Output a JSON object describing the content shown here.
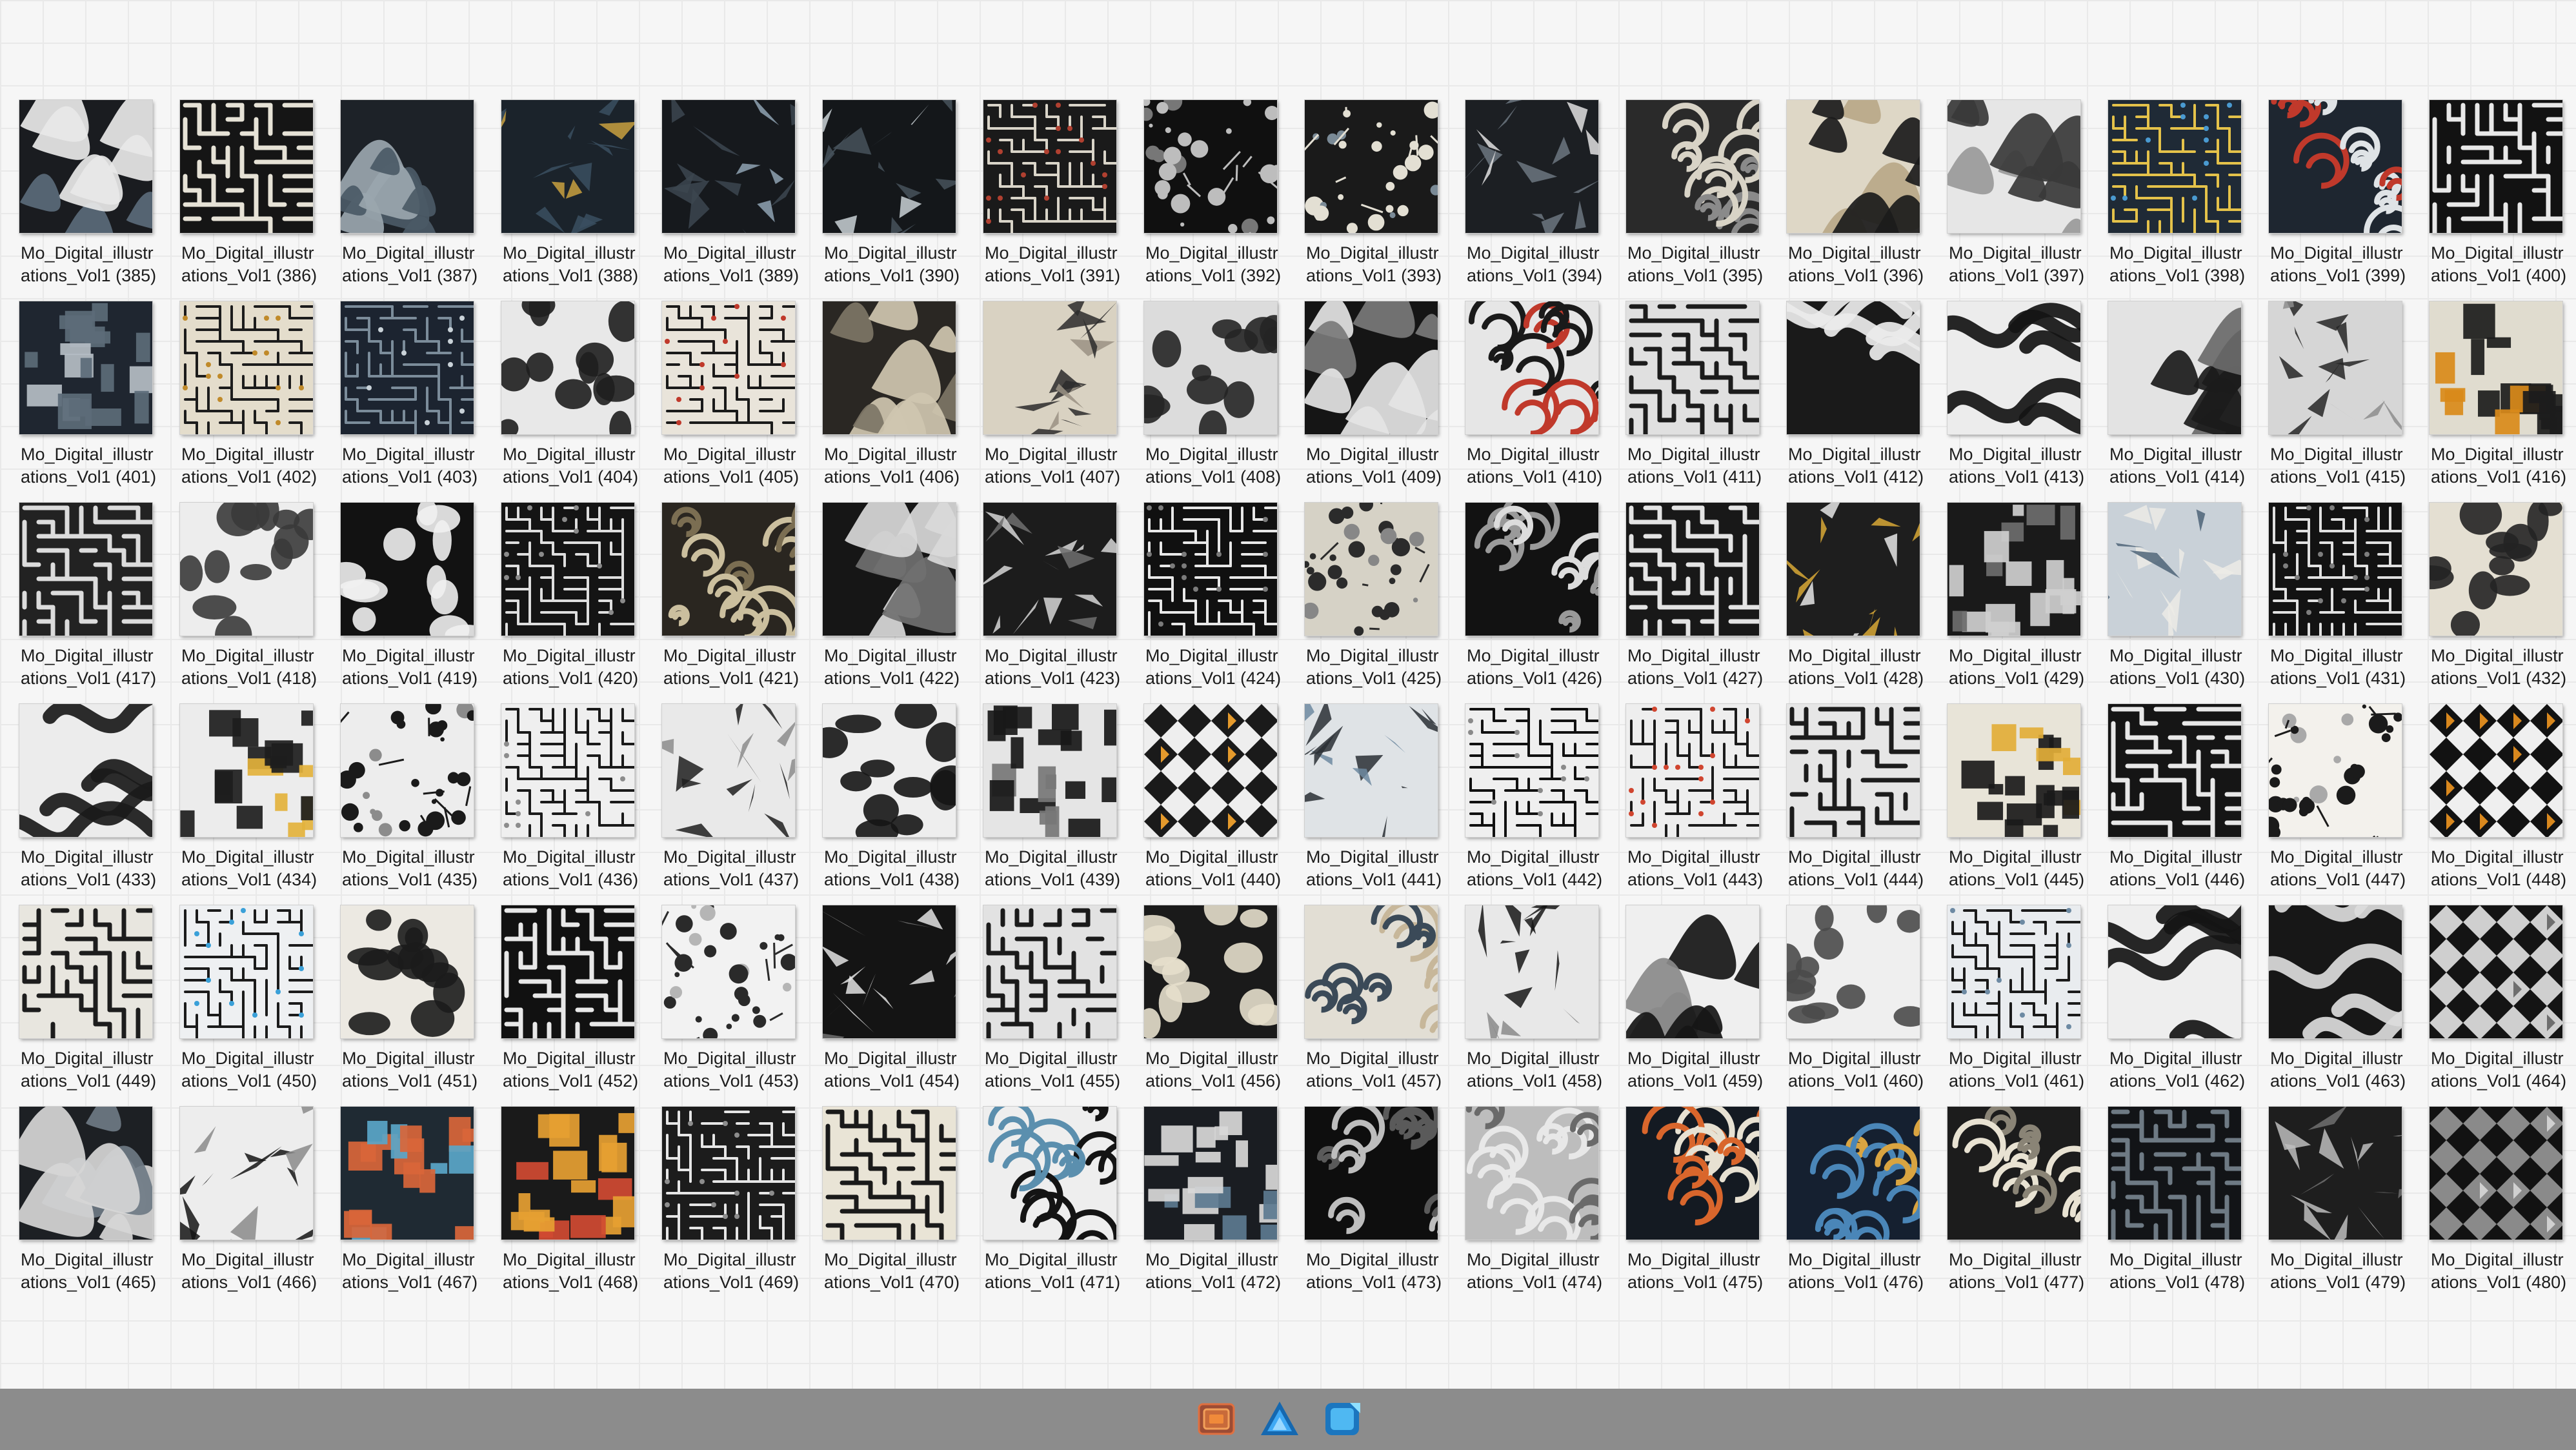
{
  "files": {
    "name_prefix": "Mo_Digital_illustrations_Vol1",
    "first_index": 385,
    "last_index": 480,
    "columns": 16,
    "items": [
      {
        "line1": "Mo_Digital_illustr",
        "line2": "ations_Vol1 (385)",
        "pattern": "blob",
        "bg": "#1a1c20",
        "fg": "#e8e8e8",
        "accent": "#5a6a7a"
      },
      {
        "line1": "Mo_Digital_illustr",
        "line2": "ations_Vol1 (386)",
        "pattern": "maze",
        "bg": "#151515",
        "fg": "#e6e2d6",
        "accent": "#9a9a9a"
      },
      {
        "line1": "Mo_Digital_illustr",
        "line2": "ations_Vol1 (387)",
        "pattern": "blob",
        "bg": "#1d2228",
        "fg": "#4b5a66",
        "accent": "#9aa6ae"
      },
      {
        "line1": "Mo_Digital_illustr",
        "line2": "ations_Vol1 (388)",
        "pattern": "shard",
        "bg": "#1b232b",
        "fg": "#3a4f60",
        "accent": "#c8a040"
      },
      {
        "line1": "Mo_Digital_illustr",
        "line2": "ations_Vol1 (389)",
        "pattern": "shard",
        "bg": "#16191d",
        "fg": "#3c4650",
        "accent": "#8fa3b3"
      },
      {
        "line1": "Mo_Digital_illustr",
        "line2": "ations_Vol1 (390)",
        "pattern": "shard",
        "bg": "#14171a",
        "fg": "#46525c",
        "accent": "#c9d1d6"
      },
      {
        "line1": "Mo_Digital_illustr",
        "line2": "ations_Vol1 (391)",
        "pattern": "circuit",
        "bg": "#1a1a1a",
        "fg": "#d9d4c8",
        "accent": "#b04030"
      },
      {
        "line1": "Mo_Digital_illustr",
        "line2": "ations_Vol1 (392)",
        "pattern": "dots",
        "bg": "#101010",
        "fg": "#bdbdbd",
        "accent": "#777777"
      },
      {
        "line1": "Mo_Digital_illustr",
        "line2": "ations_Vol1 (393)",
        "pattern": "dots",
        "bg": "#1a1a1a",
        "fg": "#e3dfd3",
        "accent": "#7a8a96"
      },
      {
        "line1": "Mo_Digital_illustr",
        "line2": "ations_Vol1 (394)",
        "pattern": "shard",
        "bg": "#1c1f23",
        "fg": "#6c7780",
        "accent": "#e0e0e0"
      },
      {
        "line1": "Mo_Digital_illustr",
        "line2": "ations_Vol1 (395)",
        "pattern": "swirl",
        "bg": "#2a2a2a",
        "fg": "#d8d3c6",
        "accent": "#8a8a8a"
      },
      {
        "line1": "Mo_Digital_illustr",
        "line2": "ations_Vol1 (396)",
        "pattern": "blob",
        "bg": "#ded7c6",
        "fg": "#1b1b1b",
        "accent": "#b8a888"
      },
      {
        "line1": "Mo_Digital_illustr",
        "line2": "ations_Vol1 (397)",
        "pattern": "blob",
        "bg": "#e6e6e6",
        "fg": "#3a3a3a",
        "accent": "#9a9a9a"
      },
      {
        "line1": "Mo_Digital_illustr",
        "line2": "ations_Vol1 (398)",
        "pattern": "circuit",
        "bg": "#1f2a36",
        "fg": "#e4c24a",
        "accent": "#4a9ad0"
      },
      {
        "line1": "Mo_Digital_illustr",
        "line2": "ations_Vol1 (399)",
        "pattern": "swirl",
        "bg": "#1e2630",
        "fg": "#dfe3e6",
        "accent": "#c0392b"
      },
      {
        "line1": "Mo_Digital_illustr",
        "line2": "ations_Vol1 (400)",
        "pattern": "maze",
        "bg": "#121212",
        "fg": "#e8e8e8",
        "accent": "#6a6a6a"
      },
      {
        "line1": "Mo_Digital_illustr",
        "line2": "ations_Vol1 (401)",
        "pattern": "blocks",
        "bg": "#1f2630",
        "fg": "#5c6b78",
        "accent": "#b5bdc4"
      },
      {
        "line1": "Mo_Digital_illustr",
        "line2": "ations_Vol1 (402)",
        "pattern": "circuit",
        "bg": "#e4ddcc",
        "fg": "#1c1c1c",
        "accent": "#c08a2a"
      },
      {
        "line1": "Mo_Digital_illustr",
        "line2": "ations_Vol1 (403)",
        "pattern": "circuit",
        "bg": "#1c2430",
        "fg": "#7b8c9a",
        "accent": "#c9d2d8"
      },
      {
        "line1": "Mo_Digital_illustr",
        "line2": "ations_Vol1 (404)",
        "pattern": "cells",
        "bg": "#e8e8e8",
        "fg": "#1e1e1e",
        "accent": "#9c9c9c"
      },
      {
        "line1": "Mo_Digital_illustr",
        "line2": "ations_Vol1 (405)",
        "pattern": "circuit",
        "bg": "#e9e4da",
        "fg": "#1a1a1a",
        "accent": "#c0392b"
      },
      {
        "line1": "Mo_Digital_illustr",
        "line2": "ations_Vol1 (406)",
        "pattern": "blob",
        "bg": "#2a2723",
        "fg": "#cfc6b0",
        "accent": "#7d7566"
      },
      {
        "line1": "Mo_Digital_illustr",
        "line2": "ations_Vol1 (407)",
        "pattern": "shard",
        "bg": "#d9d2c2",
        "fg": "#2b2b2b",
        "accent": "#9a9284"
      },
      {
        "line1": "Mo_Digital_illustr",
        "line2": "ations_Vol1 (408)",
        "pattern": "cells",
        "bg": "#dcdcdc",
        "fg": "#252525",
        "accent": "#8a8a8a"
      },
      {
        "line1": "Mo_Digital_illustr",
        "line2": "ations_Vol1 (409)",
        "pattern": "blob",
        "bg": "#151515",
        "fg": "#e4e4e4",
        "accent": "#7a7a7a"
      },
      {
        "line1": "Mo_Digital_illustr",
        "line2": "ations_Vol1 (410)",
        "pattern": "swirl",
        "bg": "#e6e6e6",
        "fg": "#1a1a1a",
        "accent": "#c0392b"
      },
      {
        "line1": "Mo_Digital_illustr",
        "line2": "ations_Vol1 (411)",
        "pattern": "maze",
        "bg": "#e0e0e0",
        "fg": "#1c1c1c",
        "accent": "#7a8a96"
      },
      {
        "line1": "Mo_Digital_illustr",
        "line2": "ations_Vol1 (412)",
        "pattern": "wave",
        "bg": "#1a1a1a",
        "fg": "#ececec",
        "accent": "#8a8a8a"
      },
      {
        "line1": "Mo_Digital_illustr",
        "line2": "ations_Vol1 (413)",
        "pattern": "wave",
        "bg": "#ececec",
        "fg": "#141414",
        "accent": "#8a8a8a"
      },
      {
        "line1": "Mo_Digital_illustr",
        "line2": "ations_Vol1 (414)",
        "pattern": "blob",
        "bg": "#e3e3e3",
        "fg": "#1b1b1b",
        "accent": "#6a6a6a"
      },
      {
        "line1": "Mo_Digital_illustr",
        "line2": "ations_Vol1 (415)",
        "pattern": "shard",
        "bg": "#d6d6d6",
        "fg": "#262626",
        "accent": "#8d8d8d"
      },
      {
        "line1": "Mo_Digital_illustr",
        "line2": "ations_Vol1 (416)",
        "pattern": "blocks",
        "bg": "#e0dccf",
        "fg": "#1c1c1c",
        "accent": "#d98a1a"
      },
      {
        "line1": "Mo_Digital_illustr",
        "line2": "ations_Vol1 (417)",
        "pattern": "maze",
        "bg": "#222222",
        "fg": "#dcdcdc",
        "accent": "#8a8a8a"
      },
      {
        "line1": "Mo_Digital_illustr",
        "line2": "ations_Vol1 (418)",
        "pattern": "cells",
        "bg": "#ededed",
        "fg": "#3a3a3a",
        "accent": "#a5a5a5"
      },
      {
        "line1": "Mo_Digital_illustr",
        "line2": "ations_Vol1 (419)",
        "pattern": "cells",
        "bg": "#121212",
        "fg": "#f0f0f0",
        "accent": "#8a8a8a"
      },
      {
        "line1": "Mo_Digital_illustr",
        "line2": "ations_Vol1 (420)",
        "pattern": "circuit",
        "bg": "#141414",
        "fg": "#dedede",
        "accent": "#8a8a8a"
      },
      {
        "line1": "Mo_Digital_illustr",
        "line2": "ations_Vol1 (421)",
        "pattern": "swirl",
        "bg": "#2a2620",
        "fg": "#cbbf9e",
        "accent": "#7b6e52"
      },
      {
        "line1": "Mo_Digital_illustr",
        "line2": "ations_Vol1 (422)",
        "pattern": "blob",
        "bg": "#161616",
        "fg": "#d9d9d9",
        "accent": "#707070"
      },
      {
        "line1": "Mo_Digital_illustr",
        "line2": "ations_Vol1 (423)",
        "pattern": "shard",
        "bg": "#1c1c1c",
        "fg": "#d6d6d6",
        "accent": "#6e6e6e"
      },
      {
        "line1": "Mo_Digital_illustr",
        "line2": "ations_Vol1 (424)",
        "pattern": "circuit",
        "bg": "#101010",
        "fg": "#e8e8e8",
        "accent": "#7b7b7b"
      },
      {
        "line1": "Mo_Digital_illustr",
        "line2": "ations_Vol1 (425)",
        "pattern": "dots",
        "bg": "#d6d2c6",
        "fg": "#2b2b2b",
        "accent": "#878787"
      },
      {
        "line1": "Mo_Digital_illustr",
        "line2": "ations_Vol1 (426)",
        "pattern": "swirl",
        "bg": "#121212",
        "fg": "#9a9a9a",
        "accent": "#dcdcdc"
      },
      {
        "line1": "Mo_Digital_illustr",
        "line2": "ations_Vol1 (427)",
        "pattern": "maze",
        "bg": "#181818",
        "fg": "#e4e4e4",
        "accent": "#767676"
      },
      {
        "line1": "Mo_Digital_illustr",
        "line2": "ations_Vol1 (428)",
        "pattern": "shard",
        "bg": "#1e1e1e",
        "fg": "#d8a836",
        "accent": "#e6e6e6"
      },
      {
        "line1": "Mo_Digital_illustr",
        "line2": "ations_Vol1 (429)",
        "pattern": "blocks",
        "bg": "#1a1a1a",
        "fg": "#cfcfcf",
        "accent": "#6d6d6d"
      },
      {
        "line1": "Mo_Digital_illustr",
        "line2": "ations_Vol1 (430)",
        "pattern": "shard",
        "bg": "#c9d1d8",
        "fg": "#ecebe6",
        "accent": "#4d6478"
      },
      {
        "line1": "Mo_Digital_illustr",
        "line2": "ations_Vol1 (431)",
        "pattern": "circuit",
        "bg": "#121212",
        "fg": "#e1e1e1",
        "accent": "#7d7d7d"
      },
      {
        "line1": "Mo_Digital_illustr",
        "line2": "ations_Vol1 (432)",
        "pattern": "cells",
        "bg": "#e4dfd2",
        "fg": "#232323",
        "accent": "#8f8a7c"
      },
      {
        "line1": "Mo_Digital_illustr",
        "line2": "ations_Vol1 (433)",
        "pattern": "wave",
        "bg": "#ececec",
        "fg": "#1a1a1a",
        "accent": "#8a8a8a"
      },
      {
        "line1": "Mo_Digital_illustr",
        "line2": "ations_Vol1 (434)",
        "pattern": "blocks",
        "bg": "#ececec",
        "fg": "#1d1d1d",
        "accent": "#e3b23c"
      },
      {
        "line1": "Mo_Digital_illustr",
        "line2": "ations_Vol1 (435)",
        "pattern": "dots",
        "bg": "#ededed",
        "fg": "#1a1a1a",
        "accent": "#8c8c8c"
      },
      {
        "line1": "Mo_Digital_illustr",
        "line2": "ations_Vol1 (436)",
        "pattern": "circuit",
        "bg": "#efefef",
        "fg": "#1a1a1a",
        "accent": "#8c8c8c"
      },
      {
        "line1": "Mo_Digital_illustr",
        "line2": "ations_Vol1 (437)",
        "pattern": "shard",
        "bg": "#e9e9e9",
        "fg": "#1f1f1f",
        "accent": "#8c8c8c"
      },
      {
        "line1": "Mo_Digital_illustr",
        "line2": "ations_Vol1 (438)",
        "pattern": "cells",
        "bg": "#eeeeee",
        "fg": "#151515",
        "accent": "#8c8c8c"
      },
      {
        "line1": "Mo_Digital_illustr",
        "line2": "ations_Vol1 (439)",
        "pattern": "blocks",
        "bg": "#e5e5e5",
        "fg": "#181818",
        "accent": "#777777"
      },
      {
        "line1": "Mo_Digital_illustr",
        "line2": "ations_Vol1 (440)",
        "pattern": "diamond",
        "bg": "#eeeeee",
        "fg": "#1a1a1a",
        "accent": "#e59a2c"
      },
      {
        "line1": "Mo_Digital_illustr",
        "line2": "ations_Vol1 (441)",
        "pattern": "shard",
        "bg": "#dfe3e6",
        "fg": "#2a2f34",
        "accent": "#6e8aa0"
      },
      {
        "line1": "Mo_Digital_illustr",
        "line2": "ations_Vol1 (442)",
        "pattern": "circuit",
        "bg": "#efefef",
        "fg": "#111111",
        "accent": "#8a8a8a"
      },
      {
        "line1": "Mo_Digital_illustr",
        "line2": "ations_Vol1 (443)",
        "pattern": "circuit",
        "bg": "#eeeeee",
        "fg": "#1b1b1b",
        "accent": "#d0452f"
      },
      {
        "line1": "Mo_Digital_illustr",
        "line2": "ations_Vol1 (444)",
        "pattern": "maze",
        "bg": "#e6e6e6",
        "fg": "#1c1c1c",
        "accent": "#8c8c8c"
      },
      {
        "line1": "Mo_Digital_illustr",
        "line2": "ations_Vol1 (445)",
        "pattern": "blocks",
        "bg": "#e8e4d8",
        "fg": "#1a1a1a",
        "accent": "#e2ae38"
      },
      {
        "line1": "Mo_Digital_illustr",
        "line2": "ations_Vol1 (446)",
        "pattern": "maze",
        "bg": "#151515",
        "fg": "#e8e8e8",
        "accent": "#7b7b7b"
      },
      {
        "line1": "Mo_Digital_illustr",
        "line2": "ations_Vol1 (447)",
        "pattern": "dots",
        "bg": "#f3f1ec",
        "fg": "#1b1b1b",
        "accent": "#a9a9a9"
      },
      {
        "line1": "Mo_Digital_illustr",
        "line2": "ations_Vol1 (448)",
        "pattern": "diamond",
        "bg": "#efefef",
        "fg": "#121212",
        "accent": "#d9881e"
      },
      {
        "line1": "Mo_Digital_illustr",
        "line2": "ations_Vol1 (449)",
        "pattern": "maze",
        "bg": "#e8e6df",
        "fg": "#1d1d1d",
        "accent": "#8a8a8a"
      },
      {
        "line1": "Mo_Digital_illustr",
        "line2": "ations_Vol1 (450)",
        "pattern": "circuit",
        "bg": "#eef0f2",
        "fg": "#1b1b1b",
        "accent": "#3aa0d8"
      },
      {
        "line1": "Mo_Digital_illustr",
        "line2": "ations_Vol1 (451)",
        "pattern": "cells",
        "bg": "#ece9e2",
        "fg": "#1c1c1c",
        "accent": "#8d8d8d"
      },
      {
        "line1": "Mo_Digital_illustr",
        "line2": "ations_Vol1 (452)",
        "pattern": "maze",
        "bg": "#111111",
        "fg": "#e8e8e8",
        "accent": "#707070"
      },
      {
        "line1": "Mo_Digital_illustr",
        "line2": "ations_Vol1 (453)",
        "pattern": "dots",
        "bg": "#f2f2f2",
        "fg": "#2a2a2a",
        "accent": "#b5b5b5"
      },
      {
        "line1": "Mo_Digital_illustr",
        "line2": "ations_Vol1 (454)",
        "pattern": "shard",
        "bg": "#141414",
        "fg": "#e2e2e2",
        "accent": "#707070"
      },
      {
        "line1": "Mo_Digital_illustr",
        "line2": "ations_Vol1 (455)",
        "pattern": "maze",
        "bg": "#e2e2e2",
        "fg": "#1b1b1b",
        "accent": "#8a8a8a"
      },
      {
        "line1": "Mo_Digital_illustr",
        "line2": "ations_Vol1 (456)",
        "pattern": "cells",
        "bg": "#1a1a1a",
        "fg": "#e6dfcc",
        "accent": "#8f8674"
      },
      {
        "line1": "Mo_Digital_illustr",
        "line2": "ations_Vol1 (457)",
        "pattern": "swirl",
        "bg": "#e2ded4",
        "fg": "#3b4a58",
        "accent": "#c7b79a"
      },
      {
        "line1": "Mo_Digital_illustr",
        "line2": "ations_Vol1 (458)",
        "pattern": "shard",
        "bg": "#e8e8e8",
        "fg": "#161616",
        "accent": "#8a8a8a"
      },
      {
        "line1": "Mo_Digital_illustr",
        "line2": "ations_Vol1 (459)",
        "pattern": "blob",
        "bg": "#efefef",
        "fg": "#161616",
        "accent": "#8a8a8a"
      },
      {
        "line1": "Mo_Digital_illustr",
        "line2": "ations_Vol1 (460)",
        "pattern": "cells",
        "bg": "#efefef",
        "fg": "#4a4a4a",
        "accent": "#b1b1b1"
      },
      {
        "line1": "Mo_Digital_illustr",
        "line2": "ations_Vol1 (461)",
        "pattern": "circuit",
        "bg": "#e9ecef",
        "fg": "#1b1b1b",
        "accent": "#6d8aa3"
      },
      {
        "line1": "Mo_Digital_illustr",
        "line2": "ations_Vol1 (462)",
        "pattern": "wave",
        "bg": "#eeeeee",
        "fg": "#151515",
        "accent": "#8a8a8a"
      },
      {
        "line1": "Mo_Digital_illustr",
        "line2": "ations_Vol1 (463)",
        "pattern": "wave",
        "bg": "#171717",
        "fg": "#dcdcdc",
        "accent": "#777777"
      },
      {
        "line1": "Mo_Digital_illustr",
        "line2": "ations_Vol1 (464)",
        "pattern": "diamond",
        "bg": "#141414",
        "fg": "#cfcfcf",
        "accent": "#6e6e6e"
      },
      {
        "line1": "Mo_Digital_illustr",
        "line2": "ations_Vol1 (465)",
        "pattern": "blob",
        "bg": "#1d2024",
        "fg": "#d6d6d6",
        "accent": "#6e7a84"
      },
      {
        "line1": "Mo_Digital_illustr",
        "line2": "ations_Vol1 (466)",
        "pattern": "shard",
        "bg": "#ededed",
        "fg": "#141414",
        "accent": "#8a8a8a"
      },
      {
        "line1": "Mo_Digital_illustr",
        "line2": "ations_Vol1 (467)",
        "pattern": "blocks",
        "bg": "#1f2a33",
        "fg": "#d9663a",
        "accent": "#5aa6c8"
      },
      {
        "line1": "Mo_Digital_illustr",
        "line2": "ations_Vol1 (468)",
        "pattern": "blocks",
        "bg": "#1a1a1a",
        "fg": "#e6a032",
        "accent": "#d04a32"
      },
      {
        "line1": "Mo_Digital_illustr",
        "line2": "ations_Vol1 (469)",
        "pattern": "circuit",
        "bg": "#1c1c1c",
        "fg": "#e6e6e6",
        "accent": "#8d8d8d"
      },
      {
        "line1": "Mo_Digital_illustr",
        "line2": "ations_Vol1 (470)",
        "pattern": "maze",
        "bg": "#e9e4d6",
        "fg": "#1a1a1a",
        "accent": "#8b8577"
      },
      {
        "line1": "Mo_Digital_illustr",
        "line2": "ations_Vol1 (471)",
        "pattern": "swirl",
        "bg": "#eeeeee",
        "fg": "#141414",
        "accent": "#5b8fae"
      },
      {
        "line1": "Mo_Digital_illustr",
        "line2": "ations_Vol1 (472)",
        "pattern": "blocks",
        "bg": "#1a1d22",
        "fg": "#d8d8d8",
        "accent": "#5c7a90"
      },
      {
        "line1": "Mo_Digital_illustr",
        "line2": "ations_Vol1 (473)",
        "pattern": "swirl",
        "bg": "#0e0e0e",
        "fg": "#5a5a5a",
        "accent": "#bdbdbd"
      },
      {
        "line1": "Mo_Digital_illustr",
        "line2": "ations_Vol1 (474)",
        "pattern": "swirl",
        "bg": "#bdbdbd",
        "fg": "#e8e8e8",
        "accent": "#6a6a6a"
      },
      {
        "line1": "Mo_Digital_illustr",
        "line2": "ations_Vol1 (475)",
        "pattern": "swirl",
        "bg": "#141a22",
        "fg": "#d9662c",
        "accent": "#e7e1d2"
      },
      {
        "line1": "Mo_Digital_illustr",
        "line2": "ations_Vol1 (476)",
        "pattern": "swirl",
        "bg": "#152030",
        "fg": "#4a86b8",
        "accent": "#d9a441"
      },
      {
        "line1": "Mo_Digital_illustr",
        "line2": "ations_Vol1 (477)",
        "pattern": "swirl",
        "bg": "#1c1c1c",
        "fg": "#e8e2d2",
        "accent": "#8a8476"
      },
      {
        "line1": "Mo_Digital_illustr",
        "line2": "ations_Vol1 (478)",
        "pattern": "maze",
        "bg": "#121417",
        "fg": "#6e7a84",
        "accent": "#c4ccd2"
      },
      {
        "line1": "Mo_Digital_illustr",
        "line2": "ations_Vol1 (479)",
        "pattern": "shard",
        "bg": "#1e1e1e",
        "fg": "#bdbdbd",
        "accent": "#707070"
      },
      {
        "line1": "Mo_Digital_illustr",
        "line2": "ations_Vol1 (480)",
        "pattern": "diamond",
        "bg": "#121212",
        "fg": "#8a8a8a",
        "accent": "#d0d0d0"
      }
    ]
  },
  "taskbar": {
    "apps": [
      {
        "name": "file-explorer-icon",
        "color": "#e05a2a",
        "accent": "#ffb347"
      },
      {
        "name": "affinity-designer-icon",
        "color": "#1d8fd8",
        "accent": "#7fd3ff"
      },
      {
        "name": "affinity-photo-icon",
        "color": "#2aa3e0",
        "accent": "#8fe0ff"
      }
    ]
  }
}
